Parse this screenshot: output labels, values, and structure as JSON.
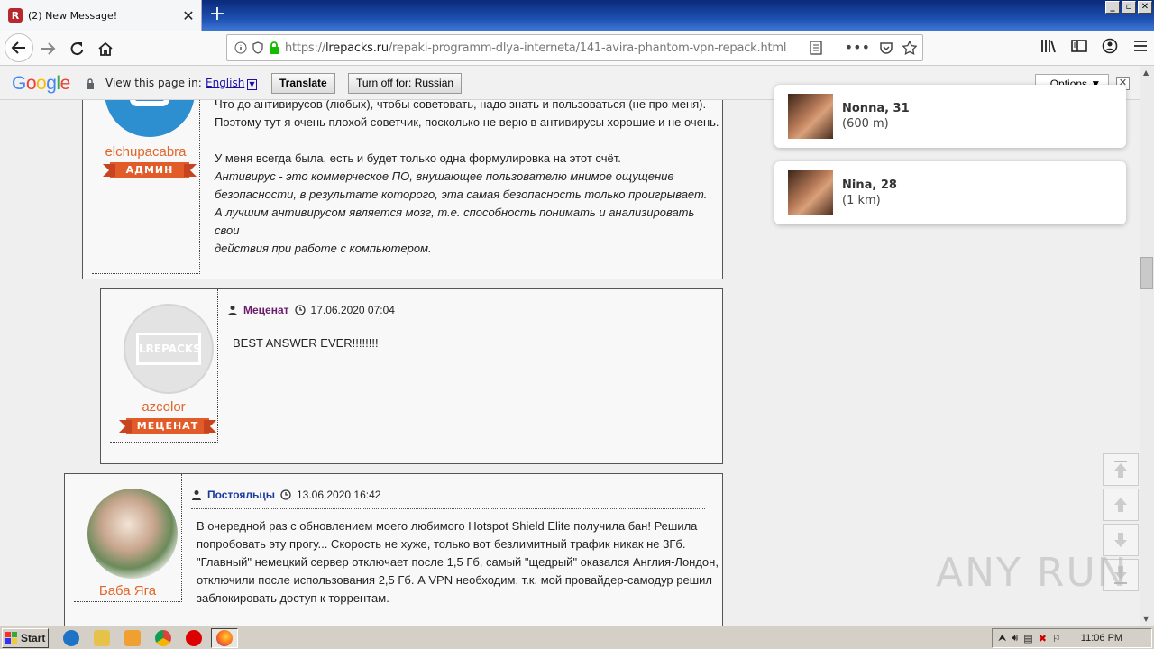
{
  "browser": {
    "tab_title": "(2) New Message!",
    "url_prefix": "https://",
    "url_host": "lrepacks.ru",
    "url_path": "/repaki-programm-dlya-interneta/141-avira-phantom-vpn-repack.html"
  },
  "translate_bar": {
    "label": "View this page in:",
    "language": "English",
    "translate_button": "Translate",
    "turn_off_button": "Turn off for: Russian",
    "options_button": "Options ▼"
  },
  "posts": [
    {
      "author": "elchupacabra",
      "rank": "АДМИН",
      "body": [
        "Что до антивирусов (любых), чтобы советовать, надо знать и пользоваться (не про меня).",
        "Поэтому тут я очень плохой советчик, посколько не верю в антивирусы хорошие и не очень.",
        "",
        "У меня всегда была, есть и будет только одна формулировка на этот счёт.",
        "Антивирус - это коммерческое ПО, внушающее пользователю мнимое ощущение",
        "безопасности, в результате которого, эта самая безопасность только проигрывает.",
        "А лучшим антивирусом является мозг, т.е. способность понимать и анализировать свои",
        "действия при работе с компьютером."
      ]
    },
    {
      "author": "azcolor",
      "rank": "МЕЦЕНАТ",
      "group": "Меценат",
      "date": "17.06.2020 07:04",
      "avatar_text": "LREPACKS",
      "body": "BEST ANSWER EVER!!!!!!!!"
    },
    {
      "author": "Баба Яга",
      "group": "Постояльцы",
      "date": "13.06.2020 16:42",
      "body": [
        "В очередной раз с обновлением моего любимого Hotspot Shield Elite получила бан! Решила",
        "попробовать эту прогу... Скорость не хуже, только вот безлимитный трафик никак не 3Гб.",
        "\"Главный\" немецкий сервер отключает после 1,5 Гб, самый \"щедрый\" оказался Англия-Лондон,",
        "отключили после использования 2,5 Гб. А VPN необходим, т.к. мой провайдер-самодур решил",
        "заблокировать доступ к торрентам."
      ]
    }
  ],
  "notifications": [
    {
      "name": "Nonna, 31",
      "distance": "(600 m)"
    },
    {
      "name": "Nina, 28",
      "distance": "(1 km)"
    }
  ],
  "watermark": "ANY RUN",
  "taskbar": {
    "start": "Start",
    "clock": "11:06 PM"
  }
}
